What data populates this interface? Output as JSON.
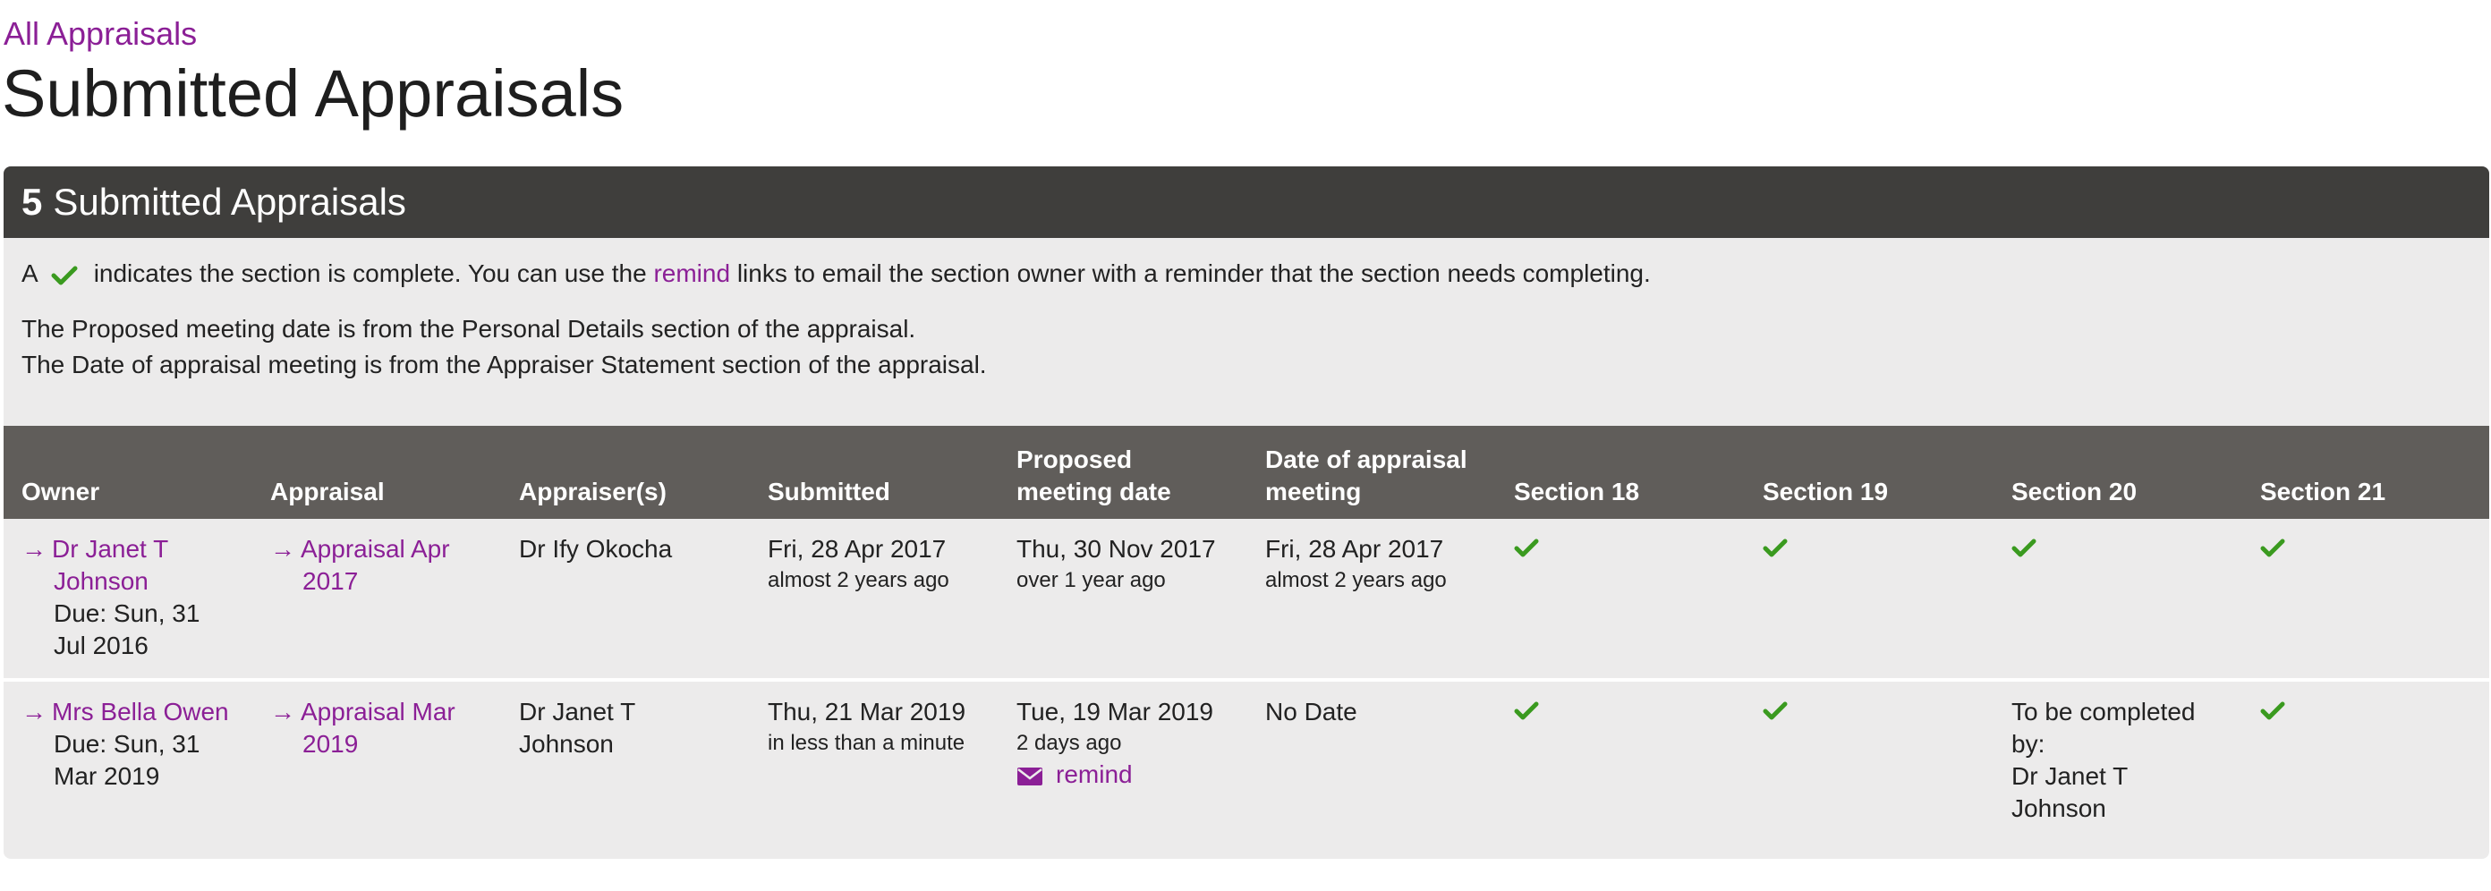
{
  "breadcrumb": {
    "label": "All Appraisals"
  },
  "page": {
    "title": "Submitted Appraisals"
  },
  "panel": {
    "count": "5",
    "title": "Submitted Appraisals",
    "info": {
      "line1_prefix": "A",
      "line1_middle": "indicates the section is complete. You can use the",
      "remind_word": "remind",
      "line1_suffix": "links to email the section owner with a reminder that the section needs completing.",
      "line2": "The Proposed meeting date is from the Personal Details section of the appraisal.",
      "line3": "The Date of appraisal meeting is from the Appraiser Statement section of the appraisal."
    }
  },
  "table": {
    "headers": {
      "owner": "Owner",
      "appraisal": "Appraisal",
      "appraisers": "Appraiser(s)",
      "submitted": "Submitted",
      "proposed": "Proposed meeting date",
      "meeting": "Date of appraisal meeting",
      "s18": "Section 18",
      "s19": "Section 19",
      "s20": "Section 20",
      "s21": "Section 21"
    },
    "rows": [
      {
        "owner_line1": "Dr Janet T",
        "owner_line2": "Johnson",
        "due": "Due: Sun, 31 Jul 2016",
        "appraisal_line1": "Appraisal Apr",
        "appraisal_line2": "2017",
        "appraisers": "Dr Ify Okocha",
        "submitted": "Fri, 28 Apr 2017",
        "submitted_rel": "almost 2 years ago",
        "proposed": "Thu, 30 Nov 2017",
        "proposed_rel": "over 1 year ago",
        "meeting": "Fri, 28 Apr 2017",
        "meeting_rel": "almost 2 years ago",
        "s18": "complete",
        "s19": "complete",
        "s20": "complete",
        "s21": "complete"
      },
      {
        "owner_line1": "Mrs Bella Owen",
        "due": "Due: Sun, 31 Mar 2019",
        "appraisal_line1": "Appraisal Mar",
        "appraisal_line2": "2019",
        "appraisers": "Dr Janet T Johnson",
        "submitted": "Thu, 21 Mar 2019",
        "submitted_rel": "in less than a minute",
        "proposed": "Tue, 19 Mar 2019",
        "proposed_rel": "2 days ago",
        "remind_label": "remind",
        "meeting": "No Date",
        "s18": "complete",
        "s19": "complete",
        "s20_pending_label": "To be completed by:",
        "s20_pending_by": "Dr Janet T Johnson",
        "s21": "complete"
      }
    ]
  },
  "colors": {
    "link": "#8b1f96",
    "check": "#3a9a1f",
    "header_dark": "#3f3e3c",
    "table_header": "#605d5a",
    "panel_bg": "#ecebeb"
  },
  "icons": {
    "complete": "check-icon",
    "link_arrow": "arrow-right-icon",
    "remind": "envelope-icon"
  }
}
